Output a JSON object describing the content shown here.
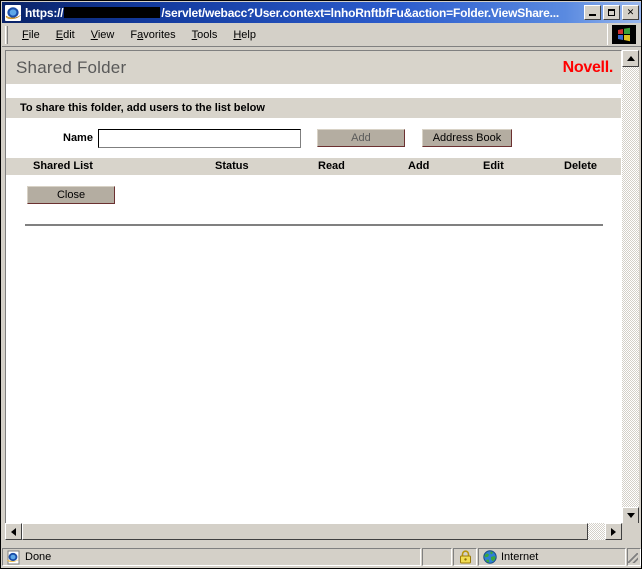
{
  "browser": {
    "title_prefix": "https://",
    "title_redacted": true,
    "title_suffix": "/servlet/webacc?User.context=lnhoRnftbfFu&action=Folder.ViewShare...",
    "app_icon": "internet-explorer-icon",
    "window_buttons": {
      "minimize": "minimize-button",
      "maximize": "maximize-button",
      "close": "close-button",
      "close_label": "✕"
    },
    "menu": [
      {
        "label": "File",
        "pre": "",
        "accel": "F",
        "post": "ile"
      },
      {
        "label": "Edit",
        "pre": "",
        "accel": "E",
        "post": "dit"
      },
      {
        "label": "View",
        "pre": "",
        "accel": "V",
        "post": "iew"
      },
      {
        "label": "Favorites",
        "pre": "F",
        "accel": "a",
        "post": "vorites"
      },
      {
        "label": "Tools",
        "pre": "",
        "accel": "T",
        "post": "ools"
      },
      {
        "label": "Help",
        "pre": "",
        "accel": "H",
        "post": "elp"
      }
    ],
    "statusbar": {
      "status_text": "Done",
      "security_icon": "lock-icon",
      "zone_icon": "globe-icon",
      "zone_text": "Internet"
    }
  },
  "page": {
    "title": "Shared Folder",
    "brand": "Novell.",
    "brand_color": "#ff0000",
    "instruction": "To share this folder, add users to the list below",
    "form": {
      "name_label": "Name",
      "name_value": "",
      "name_placeholder": "",
      "add_button": "Add",
      "address_book_button": "Address Book"
    },
    "table": {
      "columns": [
        "Shared List",
        "Status",
        "Read",
        "Add",
        "Edit",
        "Delete"
      ],
      "rows": []
    },
    "close_button": "Close"
  }
}
